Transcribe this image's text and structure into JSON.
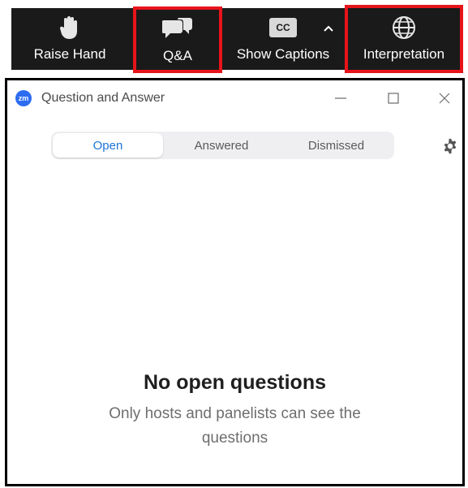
{
  "toolbar": {
    "raise_hand": {
      "label": "Raise Hand",
      "icon": "hand-icon"
    },
    "qa": {
      "label": "Q&A",
      "icon": "chat-bubbles-icon"
    },
    "captions": {
      "label": "Show Captions",
      "icon": "cc-icon",
      "badge": "CC"
    },
    "captions_menu": {
      "icon": "caret-up-icon"
    },
    "interpretation": {
      "label": "Interpretation",
      "icon": "globe-icon"
    },
    "highlight_color": "#e8141b",
    "background": "#1a1a1a"
  },
  "window": {
    "logo_text": "zm",
    "title": "Question and Answer",
    "controls": [
      "minimize-icon",
      "maximize-icon",
      "close-icon"
    ]
  },
  "tabs": [
    {
      "label": "Open",
      "active": true
    },
    {
      "label": "Answered",
      "active": false
    },
    {
      "label": "Dismissed",
      "active": false
    }
  ],
  "settings_icon": "gear-icon",
  "empty_state": {
    "title": "No open questions",
    "subtitle": "Only hosts and panelists can see the questions"
  },
  "colors": {
    "accent": "#1a73d9",
    "logo": "#2d6cf0"
  }
}
